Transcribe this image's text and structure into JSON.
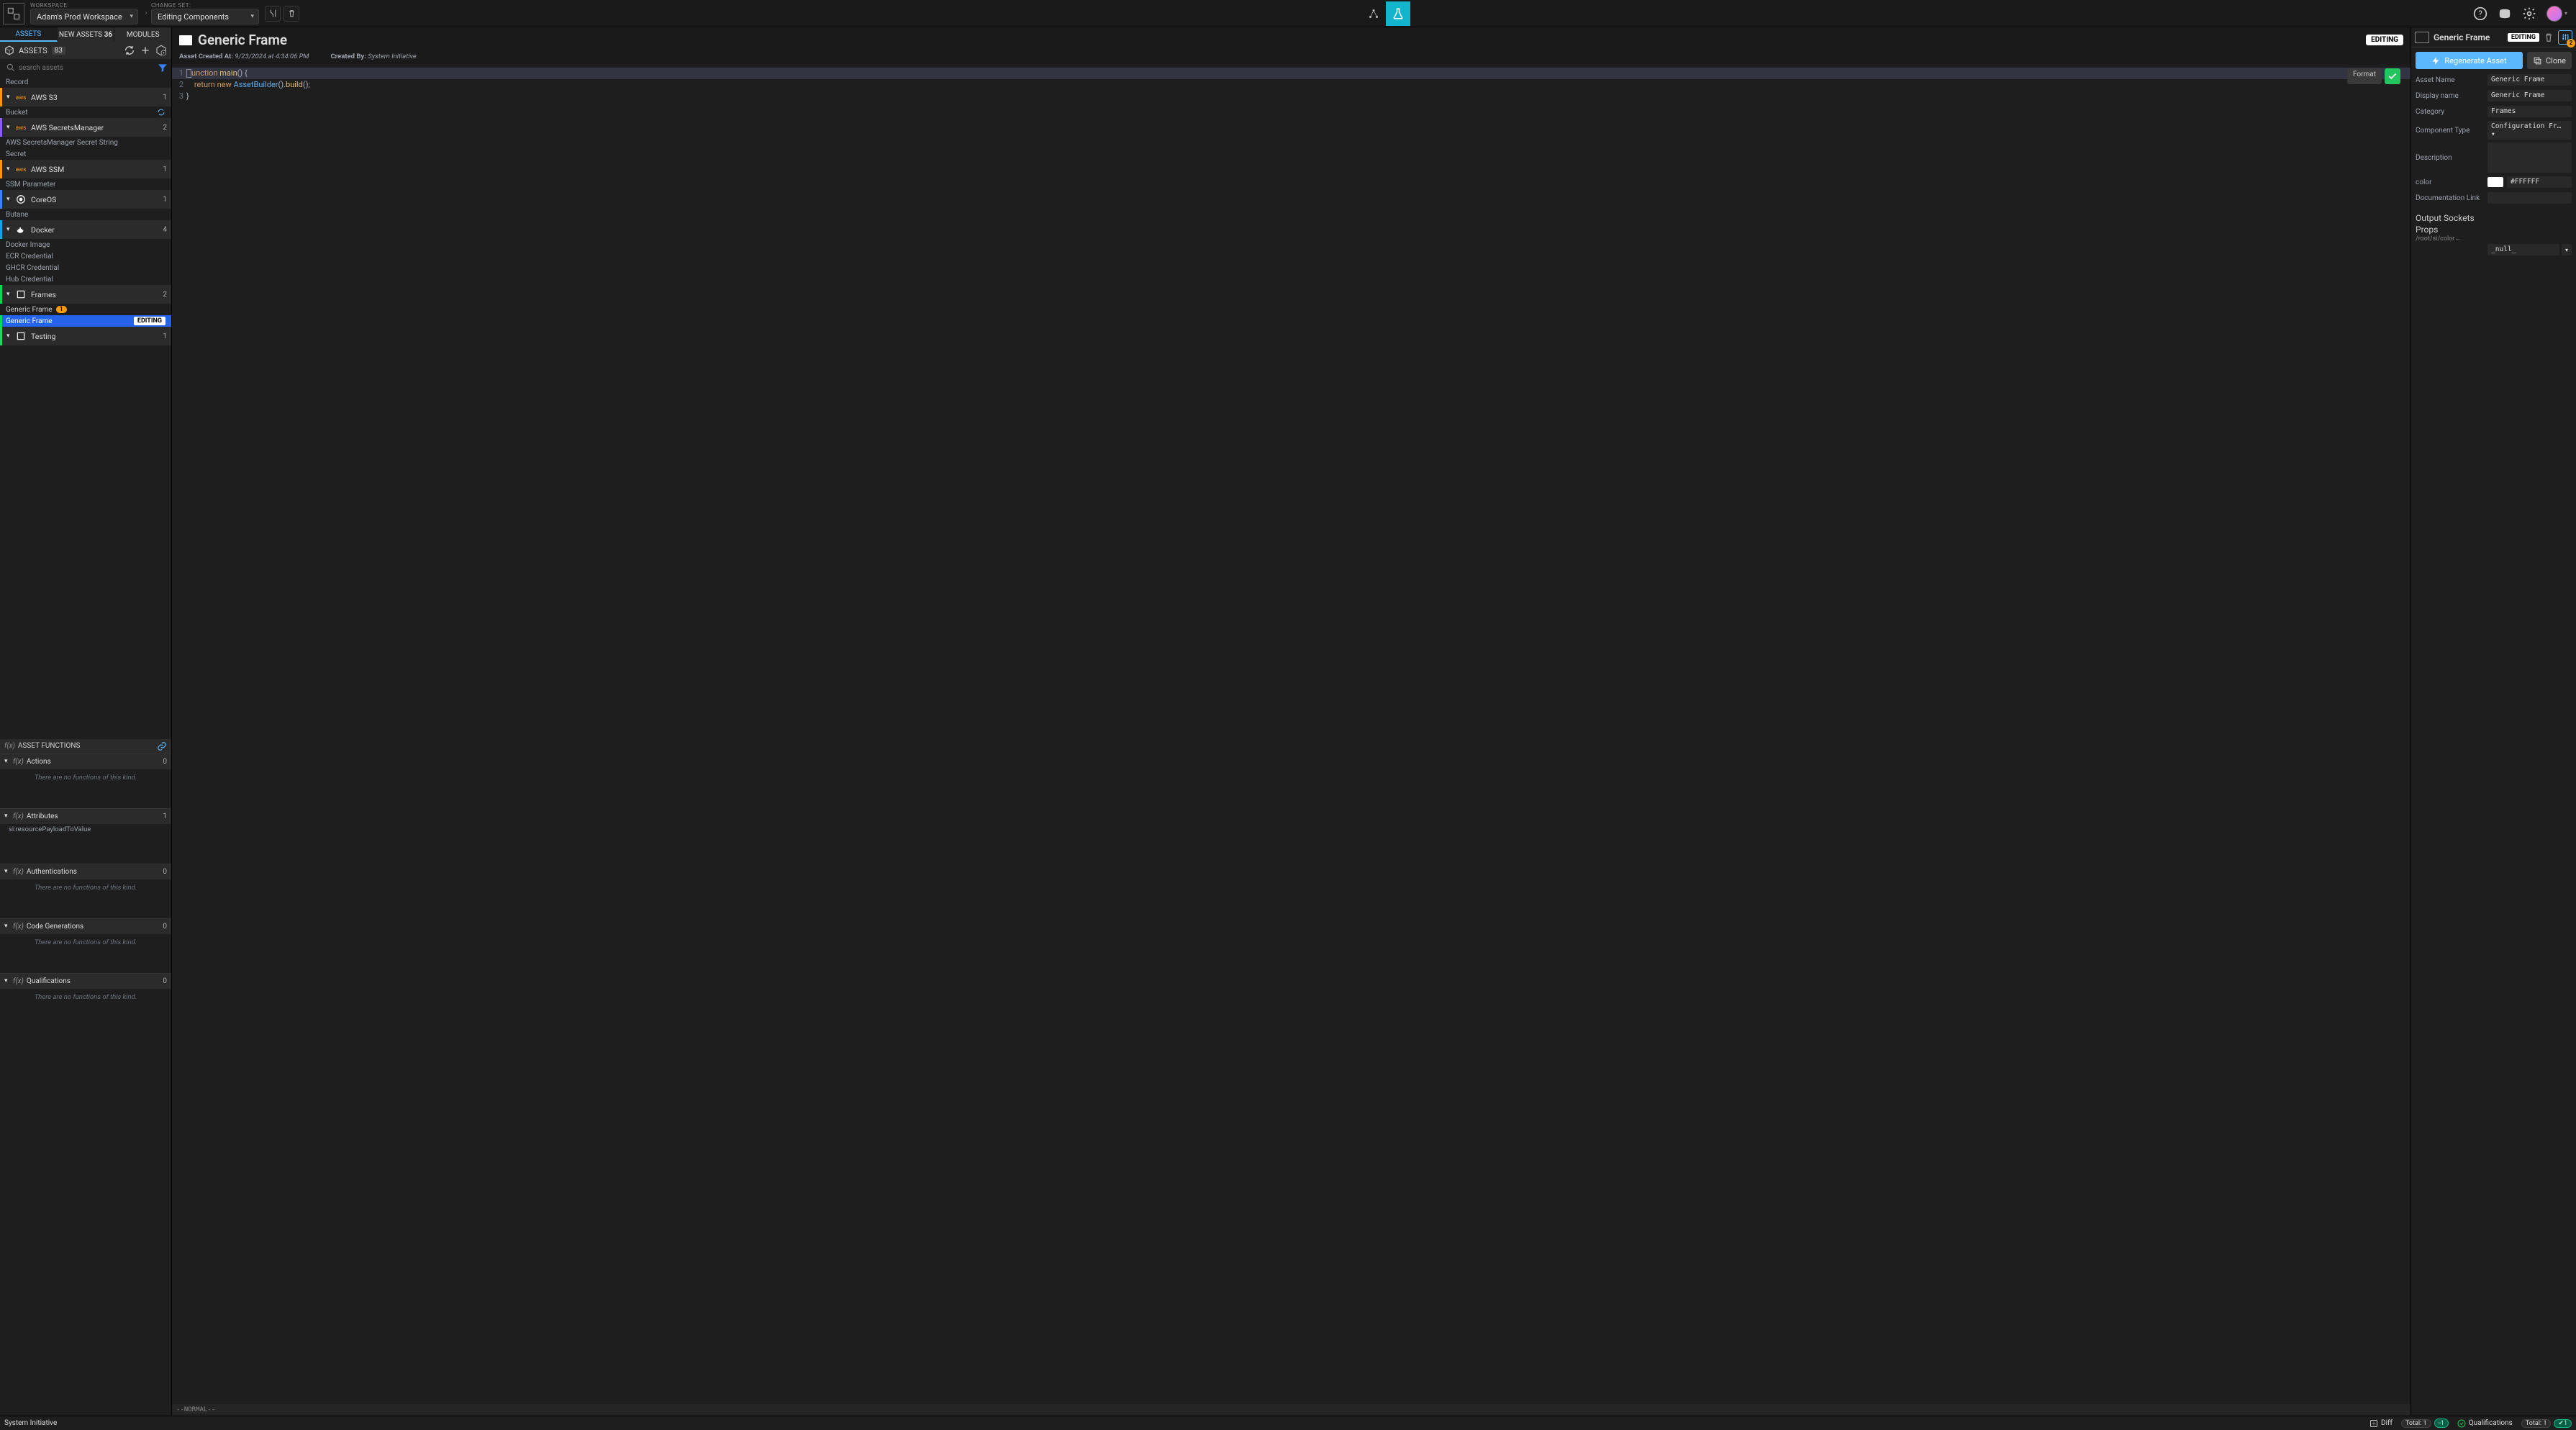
{
  "top": {
    "workspace_label": "WORKSPACE:",
    "workspace_value": "Adam's Prod Workspace",
    "changeset_label": "CHANGE SET:",
    "changeset_value": "Editing Components"
  },
  "tabs": {
    "assets": "ASSETS",
    "new_assets": "NEW ASSETS",
    "new_assets_count": "36",
    "modules": "MODULES"
  },
  "assets": {
    "title": "ASSETS",
    "count": "83",
    "search_placeholder": "search assets",
    "record": "Record",
    "cats": [
      {
        "name": "AWS S3",
        "cnt": "1",
        "cls": "aws",
        "items": [
          {
            "name": "Bucket",
            "special": true
          }
        ]
      },
      {
        "name": "AWS SecretsManager",
        "cnt": "2",
        "cls": "purple",
        "items": [
          {
            "name": "AWS SecretsManager Secret String"
          },
          {
            "name": "Secret"
          }
        ]
      },
      {
        "name": "AWS SSM",
        "cnt": "1",
        "cls": "aws",
        "items": [
          {
            "name": "SSM Parameter"
          }
        ]
      },
      {
        "name": "CoreOS",
        "cnt": "1",
        "cls": "core",
        "items": [
          {
            "name": "Butane"
          }
        ]
      },
      {
        "name": "Docker",
        "cnt": "4",
        "cls": "docker",
        "items": [
          {
            "name": "Docker Image"
          },
          {
            "name": "ECR Credential"
          },
          {
            "name": "GHCR Credential"
          },
          {
            "name": "Hub Credential"
          }
        ]
      },
      {
        "name": "Frames",
        "cnt": "2",
        "cls": "frames",
        "items": [
          {
            "name": "Generic Frame",
            "gold": true,
            "badge": "1"
          },
          {
            "name": "Generic Frame",
            "selected": true,
            "editing": "EDITING"
          }
        ]
      },
      {
        "name": "Testing",
        "cnt": "1",
        "cls": "testing",
        "items": []
      }
    ]
  },
  "functions": {
    "title": "ASSET FUNCTIONS",
    "groups": [
      {
        "name": "Actions",
        "cnt": "0",
        "empty": "There are no functions of this kind."
      },
      {
        "name": "Attributes",
        "cnt": "1",
        "items": [
          "si:resourcePayloadToValue"
        ]
      },
      {
        "name": "Authentications",
        "cnt": "0",
        "empty": "There are no functions of this kind."
      },
      {
        "name": "Code Generations",
        "cnt": "0",
        "empty": "There are no functions of this kind."
      },
      {
        "name": "Qualifications",
        "cnt": "0",
        "empty": "There are no functions of this kind."
      }
    ]
  },
  "center": {
    "title": "Generic Frame",
    "editing": "EDITING",
    "created_label": "Asset Created At:",
    "created_value": "9/23/2024 at 4:34:06 PM",
    "by_label": "Created By:",
    "by_value": "System Initiative",
    "format": "Format",
    "status": "--NORMAL--",
    "code": {
      "l1a": "unction",
      "l1b": "main",
      "l1c": "()",
      "l1d": "{",
      "l2a": "return",
      "l2b": "new",
      "l2c": "AssetBuilder",
      "l2d": "().",
      "l2e": "build",
      "l2f": "();",
      "l3": "}"
    }
  },
  "right": {
    "title": "Generic Frame",
    "editing": "EDITING",
    "notif": "2",
    "regen": "Regenerate Asset",
    "clone": "Clone",
    "fields": {
      "asset_name_l": "Asset Name",
      "asset_name_v": "Generic Frame",
      "display_l": "Display name",
      "display_v": "Generic Frame",
      "cat_l": "Category",
      "cat_v": "Frames",
      "type_l": "Component Type",
      "type_v": "Configuration Fr…",
      "desc_l": "Description",
      "desc_v": "",
      "color_l": "color",
      "color_v": "#FFFFFF",
      "doc_l": "Documentation Link",
      "doc_v": ""
    },
    "sockets": "Output Sockets",
    "props": "Props",
    "prop_path": "/root/si/color←",
    "prop_val": "_null_"
  },
  "footer": {
    "brand": "System Initiative",
    "diff": "Diff",
    "total": "Total: 1",
    "one": "1",
    "qual": "Qualifications",
    "total2": "Total: 1",
    "one2": "1"
  }
}
